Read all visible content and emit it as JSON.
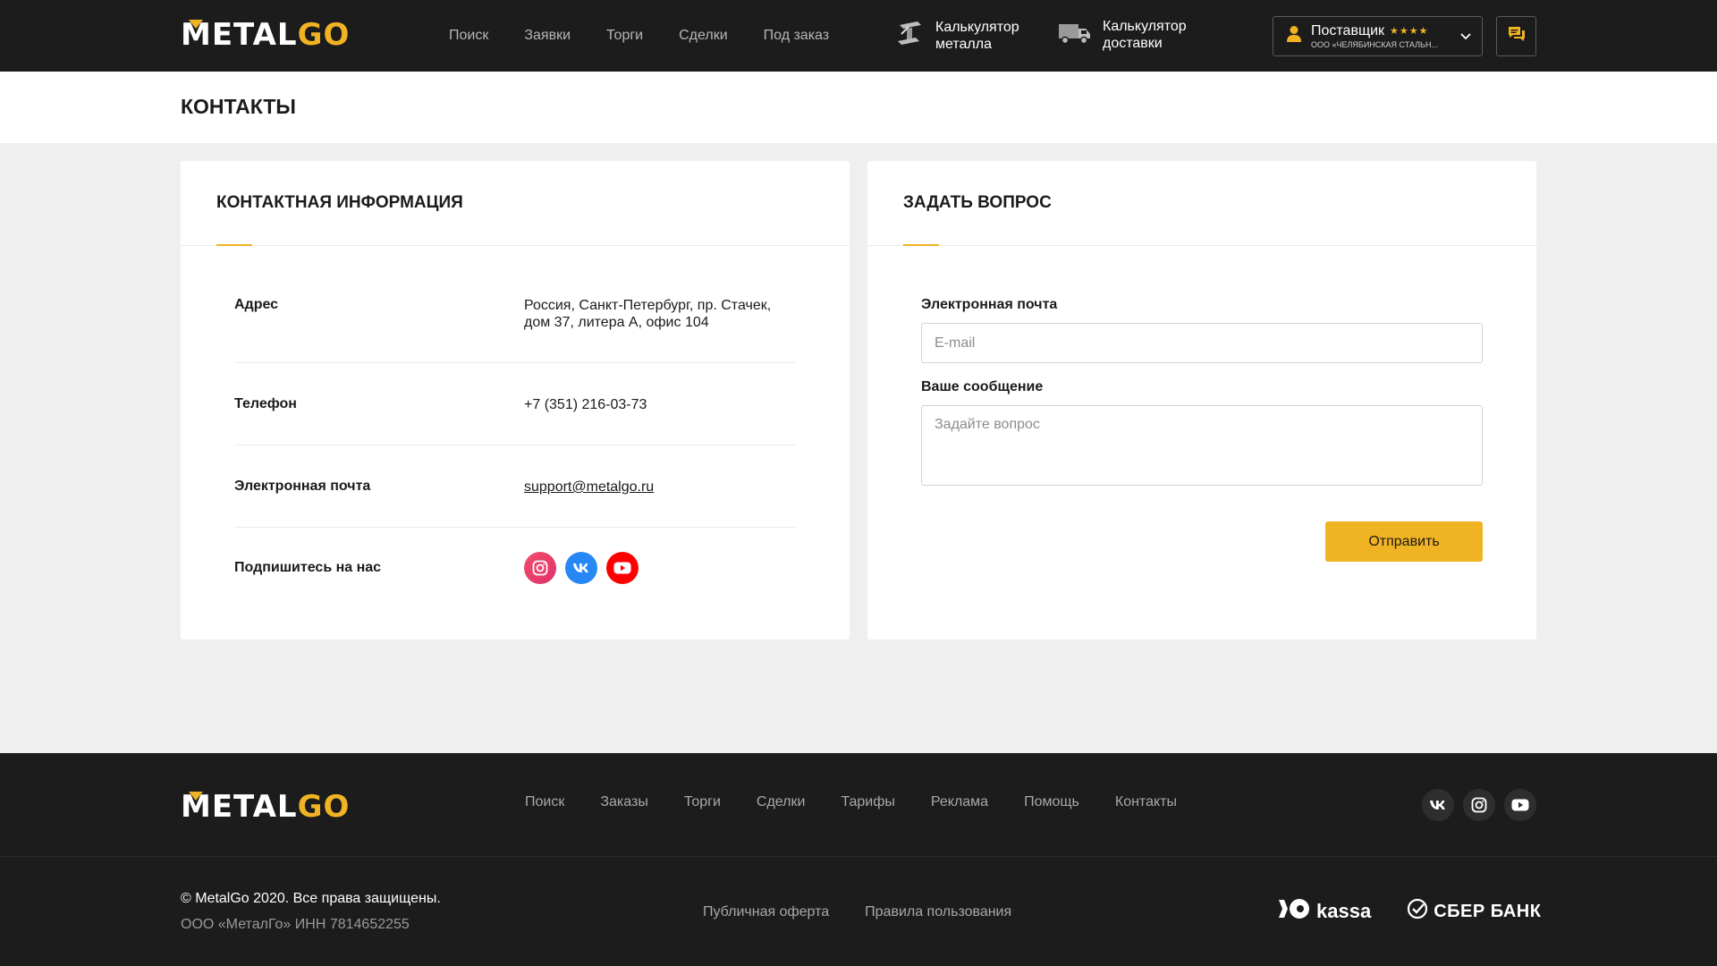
{
  "brand": {
    "metal": "METAL",
    "go": "GO",
    "accent": "#f0b323"
  },
  "header": {
    "nav": [
      "Поиск",
      "Заявки",
      "Торги",
      "Сделки",
      "Под заказ"
    ],
    "calc_metal": {
      "line1": "Калькулятор",
      "line2": "металла"
    },
    "calc_delivery": {
      "line1": "Калькулятор",
      "line2": "доставки"
    },
    "user": {
      "role": "Поставщик",
      "stars": "★★★★",
      "company": "ООО «ЧЕЛЯБИНСКАЯ СТАЛЬН..."
    }
  },
  "page": {
    "title": "КОНТАКТЫ"
  },
  "contacts": {
    "title": "КОНТАКТНАЯ ИНФОРМАЦИЯ",
    "address_label": "Адрес",
    "address_line1": "Россия, Санкт-Петербург, пр. Стачек,",
    "address_line2": "дом 37, литера А, офис 104",
    "phone_label": "Телефон",
    "phone": "+7 (351) 216-03-73",
    "email_label": "Электронная почта",
    "email": "support@metalgo.ru",
    "subscribe_label": "Подпишитесь на нас"
  },
  "question": {
    "title": "ЗАДАТЬ ВОПРОС",
    "email_label": "Электронная почта",
    "email_placeholder": "E-mail",
    "message_label": "Ваше сообщение",
    "message_placeholder": "Задайте вопрос",
    "submit": "Отправить"
  },
  "footer": {
    "nav": [
      "Поиск",
      "Заказы",
      "Торги",
      "Сделки",
      "Тарифы",
      "Реклама",
      "Помощь",
      "Контакты"
    ],
    "copyright": "© MetalGo 2020. Все права защищены.",
    "company": "ООО «МеталГо» ИНН 7814652255",
    "offer": "Публичная оферта",
    "rules": "Правила пользования",
    "kassa": "kassa",
    "sber": "СБЕР БАНК"
  }
}
